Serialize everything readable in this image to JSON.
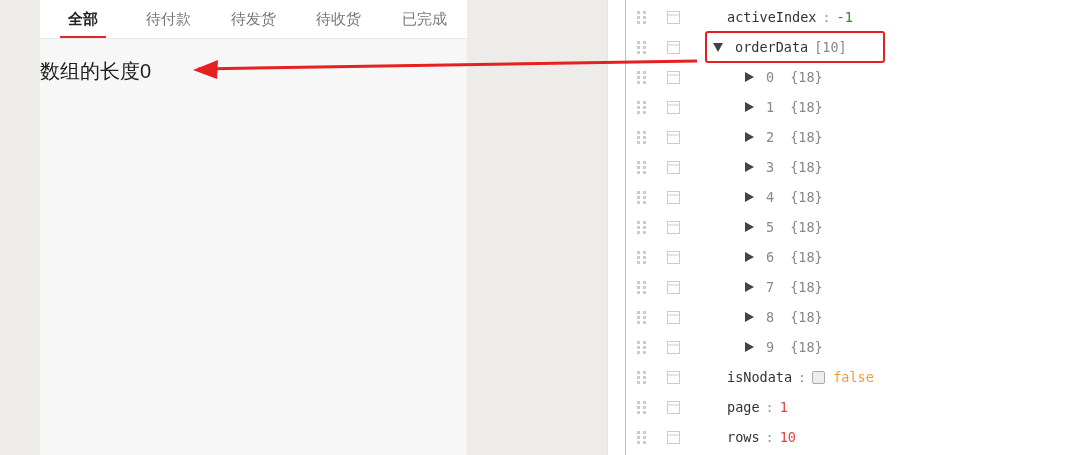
{
  "tabs": [
    {
      "label": "全部",
      "selected": true
    },
    {
      "label": "待付款",
      "selected": false
    },
    {
      "label": "待发货",
      "selected": false
    },
    {
      "label": "待收货",
      "selected": false
    },
    {
      "label": "已完成",
      "selected": false
    }
  ],
  "length_text": "数组的长度0",
  "tree": [
    {
      "kind": "number",
      "key": "activeIndex",
      "sep": ":",
      "value": "-1",
      "color": "#2a8a2a"
    },
    {
      "kind": "array",
      "key": "orderData",
      "count": "[10]",
      "expanded": true,
      "highlighted": true,
      "children": [
        {
          "kind": "object",
          "key": "0",
          "value": "{18}",
          "expanded": false
        },
        {
          "kind": "object",
          "key": "1",
          "value": "{18}",
          "expanded": false
        },
        {
          "kind": "object",
          "key": "2",
          "value": "{18}",
          "expanded": false
        },
        {
          "kind": "object",
          "key": "3",
          "value": "{18}",
          "expanded": false
        },
        {
          "kind": "object",
          "key": "4",
          "value": "{18}",
          "expanded": false
        },
        {
          "kind": "object",
          "key": "5",
          "value": "{18}",
          "expanded": false
        },
        {
          "kind": "object",
          "key": "6",
          "value": "{18}",
          "expanded": false
        },
        {
          "kind": "object",
          "key": "7",
          "value": "{18}",
          "expanded": false
        },
        {
          "kind": "object",
          "key": "8",
          "value": "{18}",
          "expanded": false
        },
        {
          "kind": "object",
          "key": "9",
          "value": "{18}",
          "expanded": false
        }
      ]
    },
    {
      "kind": "boolean",
      "key": "isNodata",
      "sep": ":",
      "value": "false",
      "checked": false
    },
    {
      "kind": "number",
      "key": "page",
      "sep": ":",
      "value": "1",
      "color": "#e0443e"
    },
    {
      "kind": "number",
      "key": "rows",
      "sep": ":",
      "value": "10",
      "color": "#e0443e"
    }
  ]
}
